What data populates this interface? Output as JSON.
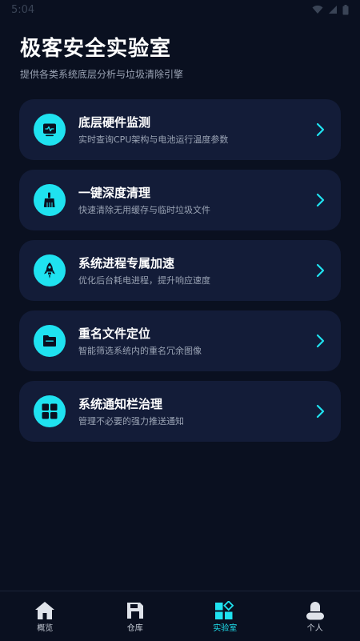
{
  "status_bar": {
    "time": "5:04"
  },
  "header": {
    "title": "极客安全实验室",
    "subtitle": "提供各类系统底层分析与垃圾清除引擎"
  },
  "cards": [
    {
      "icon": "monitor-pulse-icon",
      "title": "底层硬件监测",
      "desc": "实时查询CPU架构与电池运行温度参数"
    },
    {
      "icon": "broom-icon",
      "title": "一键深度清理",
      "desc": "快速清除无用缓存与临时垃圾文件"
    },
    {
      "icon": "rocket-icon",
      "title": "系统进程专属加速",
      "desc": "优化后台耗电进程，提升响应速度"
    },
    {
      "icon": "folder-icon",
      "title": "重名文件定位",
      "desc": "智能筛选系统内的重名冗余图像"
    },
    {
      "icon": "grid-icon",
      "title": "系统通知栏治理",
      "desc": "管理不必要的强力推送通知"
    }
  ],
  "bottom_nav": [
    {
      "icon": "home-icon",
      "label": "概览",
      "active": false
    },
    {
      "icon": "storage-icon",
      "label": "仓库",
      "active": false
    },
    {
      "icon": "lab-icon",
      "label": "实验室",
      "active": true
    },
    {
      "icon": "person-icon",
      "label": "个人",
      "active": false
    }
  ],
  "colors": {
    "background": "#0a1020",
    "card": "#131c38",
    "accent": "#1fe2f0",
    "text_secondary": "#9aa3b4"
  }
}
